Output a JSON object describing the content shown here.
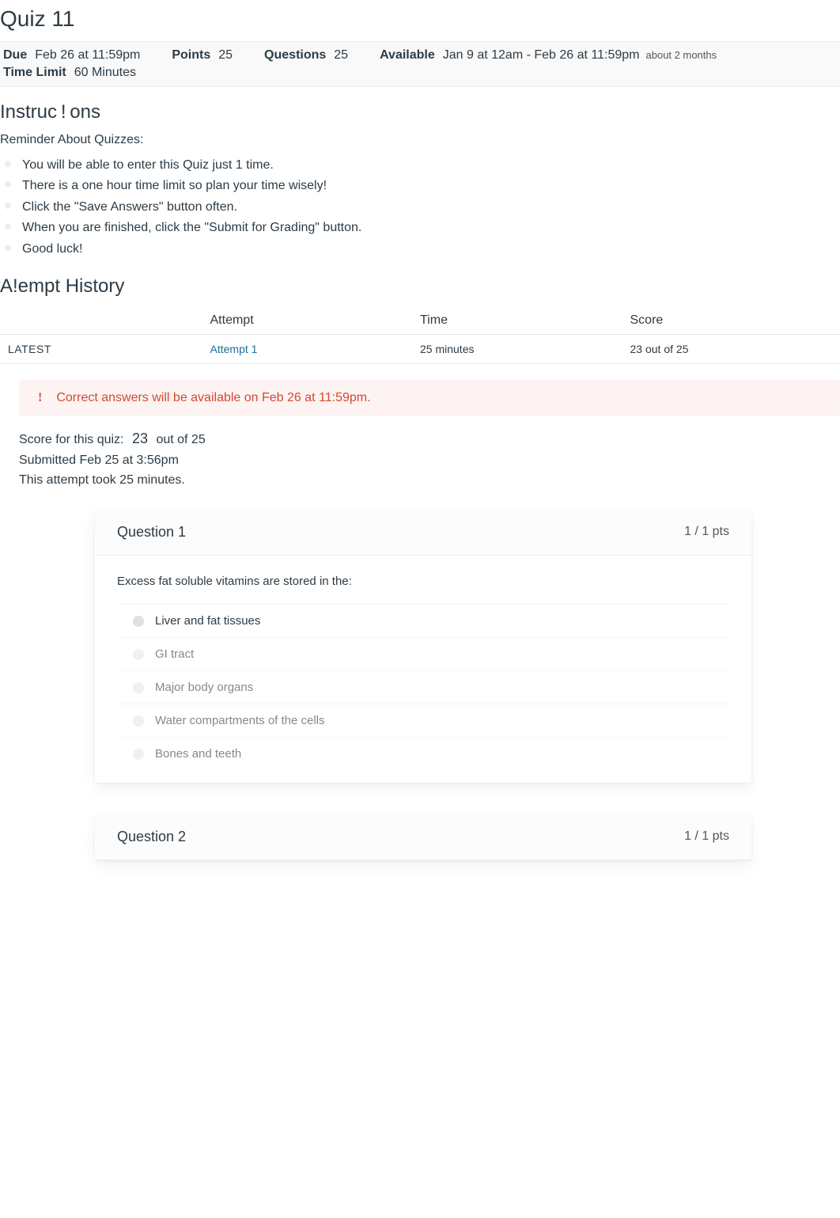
{
  "title": "Quiz 11",
  "meta": {
    "due_label": "Due",
    "due_value": "Feb 26 at 11:59pm",
    "points_label": "Points",
    "points_value": "25",
    "questions_label": "Questions",
    "questions_value": "25",
    "available_label": "Available",
    "available_value": "Jan 9 at 12am - Feb 26 at 11:59pm",
    "available_note": "about 2 months",
    "timelimit_label": "Time Limit",
    "timelimit_value": "60 Minutes"
  },
  "instructions_heading": "Instruc ! ons",
  "reminder_label": "Reminder About Quizzes:",
  "instructions": [
    "You will be able to enter this Quiz just 1 time.",
    "There is a one hour time limit so plan your time wisely!",
    "Click the \"Save Answers\" button often.",
    "When you are finished, click the \"Submit for Grading\" button.",
    "Good luck!"
  ],
  "history_heading": "A!empt History",
  "history": {
    "headers": {
      "attempt": "Attempt",
      "time": "Time",
      "score": "Score"
    },
    "rows": [
      {
        "latest": "LATEST",
        "attempt": "Attempt 1",
        "time": "25 minutes",
        "score": "23 out of 25"
      }
    ]
  },
  "alert": {
    "icon": "!",
    "text": "Correct answers will be available on Feb 26 at 11:59pm."
  },
  "score_summary": {
    "label": "Score for this quiz:",
    "score": "23",
    "out_of": "out of 25",
    "submitted": "Submitted Feb 25 at 3:56pm",
    "duration": "This attempt took 25 minutes."
  },
  "questions": [
    {
      "title": "Question 1",
      "points": "1 / 1 pts",
      "text": "Excess fat soluble vitamins are stored in the:",
      "answers": [
        {
          "text": "Liver and fat tissues",
          "selected": true
        },
        {
          "text": "GI tract",
          "selected": false
        },
        {
          "text": "Major body organs",
          "selected": false
        },
        {
          "text": "Water compartments of the cells",
          "selected": false
        },
        {
          "text": "Bones and teeth",
          "selected": false
        }
      ]
    },
    {
      "title": "Question 2",
      "points": "1 / 1 pts",
      "text": "",
      "answers": []
    }
  ]
}
